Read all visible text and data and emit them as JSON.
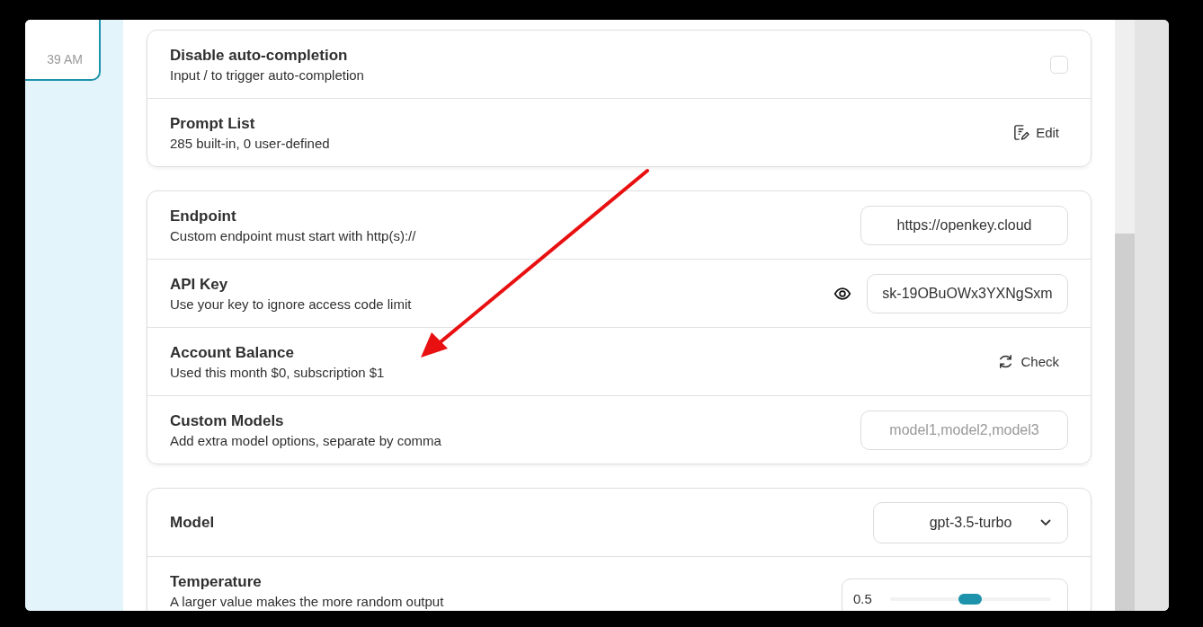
{
  "sidebar": {
    "chat_time": "39 AM"
  },
  "sections": [
    {
      "rows": [
        {
          "kind": "checkbox",
          "title": "Disable auto-completion",
          "subtitle": "Input / to trigger auto-completion",
          "checked": false
        },
        {
          "kind": "edit",
          "title": "Prompt List",
          "subtitle": "285 built-in, 0 user-defined",
          "button": "Edit"
        }
      ]
    },
    {
      "rows": [
        {
          "kind": "input",
          "title": "Endpoint",
          "subtitle": "Custom endpoint must start with http(s)://",
          "value": "https://openkey.cloud"
        },
        {
          "kind": "password",
          "title": "API Key",
          "subtitle": "Use your key to ignore access code limit",
          "value": "sk-19OBuOWx3YXNgSxm"
        },
        {
          "kind": "check",
          "title": "Account Balance",
          "subtitle": "Used this month $0, subscription $1",
          "button": "Check"
        },
        {
          "kind": "input",
          "title": "Custom Models",
          "subtitle": "Add extra model options, separate by comma",
          "placeholder": "model1,model2,model3"
        }
      ]
    },
    {
      "rows": [
        {
          "kind": "select",
          "title": "Model",
          "value": "gpt-3.5-turbo"
        },
        {
          "kind": "slider",
          "title": "Temperature",
          "subtitle": "A larger value makes the more random output",
          "value": "0.5",
          "level": 0.5
        }
      ]
    }
  ]
}
